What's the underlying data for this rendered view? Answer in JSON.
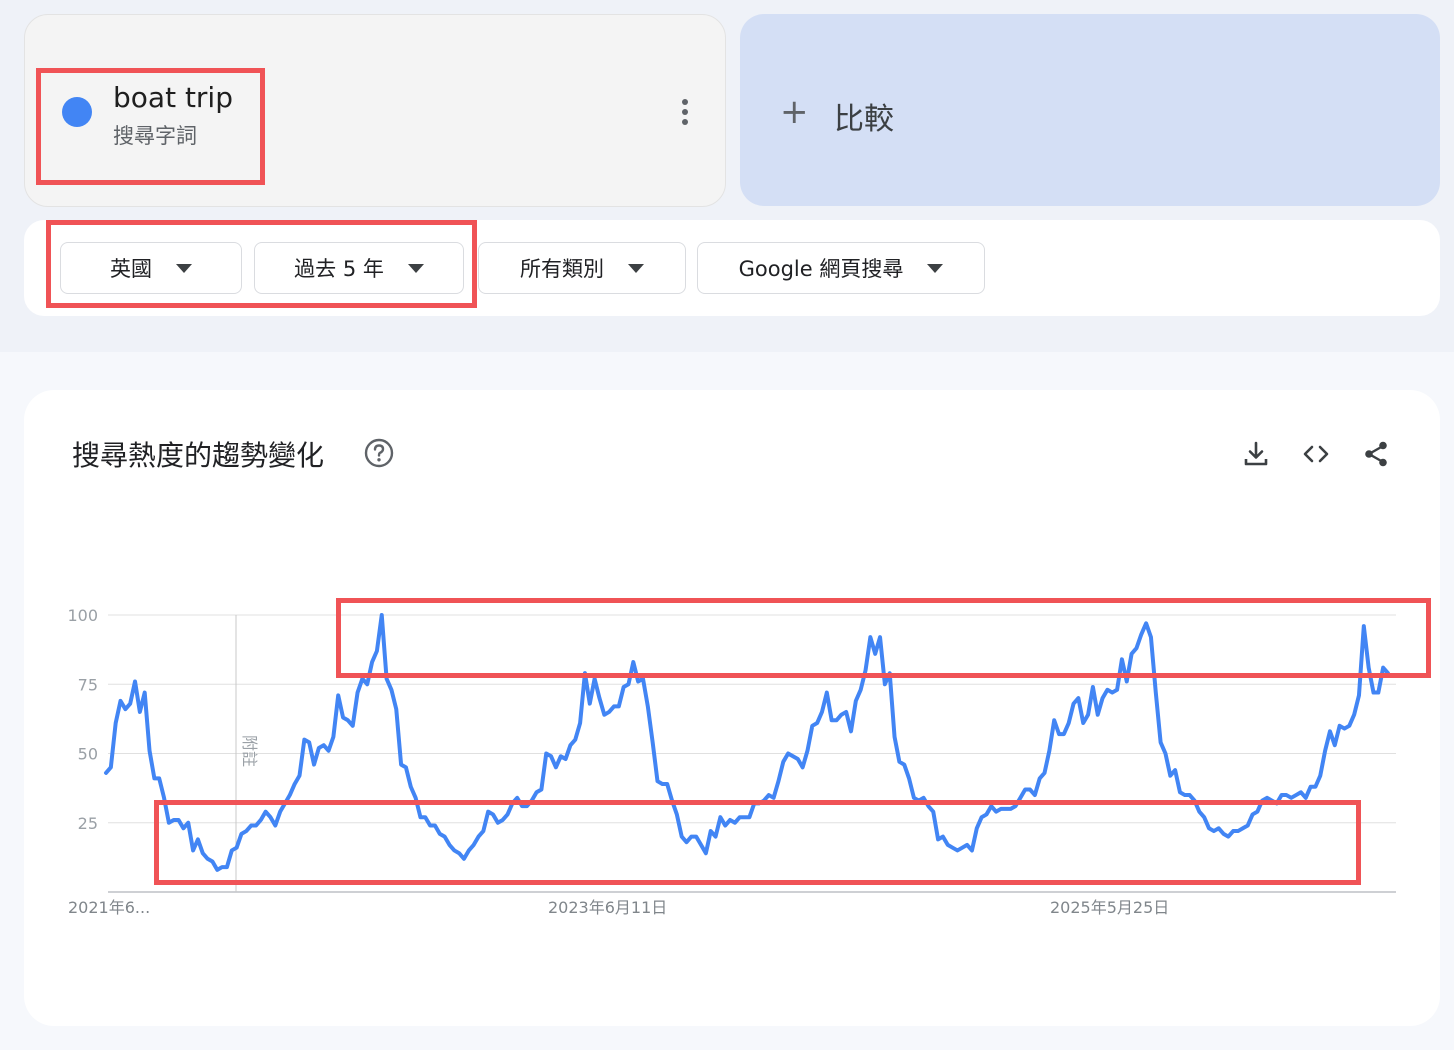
{
  "term": {
    "name": "boat trip",
    "type_label": "搜尋字詞",
    "color": "#4285f4"
  },
  "compare": {
    "plus": "+",
    "label": "比較"
  },
  "filters": [
    {
      "label": "英國"
    },
    {
      "label": "過去 5 年"
    },
    {
      "label": "所有類別"
    },
    {
      "label": "Google 網頁搜尋"
    }
  ],
  "chart_section": {
    "title": "搜尋熱度的趨勢變化",
    "help_icon": "help-circle-icon",
    "actions": [
      "download-icon",
      "embed-code-icon",
      "share-icon"
    ]
  },
  "colors": {
    "accent": "#4285f4",
    "highlight": "#f05356"
  },
  "chart_data": {
    "type": "line",
    "title": "",
    "xlabel": "",
    "ylabel": "",
    "ylim": [
      0,
      100
    ],
    "yticks": [
      25,
      50,
      75,
      100
    ],
    "xtick_labels": [
      "2021年6...",
      "2023年6月11日",
      "2025年5月25日"
    ],
    "annotation_label": "附註",
    "grid": true,
    "series": [
      {
        "name": "boat trip",
        "color": "#4285f4",
        "values": [
          43,
          45,
          61,
          69,
          66,
          68,
          76,
          65,
          72,
          51,
          41,
          41,
          34,
          25,
          26,
          26,
          23,
          25,
          15,
          19,
          14,
          12,
          11,
          8,
          9,
          9,
          15,
          16,
          21,
          22,
          24,
          24,
          26,
          29,
          27,
          24,
          29,
          32,
          35,
          39,
          42,
          55,
          54,
          46,
          52,
          53,
          51,
          56,
          71,
          63,
          62,
          60,
          72,
          77,
          75,
          83,
          87,
          100,
          77,
          73,
          66,
          46,
          45,
          38,
          34,
          27,
          27,
          24,
          24,
          21,
          20,
          17,
          15,
          14,
          12,
          15,
          17,
          20,
          22,
          29,
          28,
          25,
          26,
          28,
          32,
          34,
          31,
          31,
          33,
          36,
          37,
          50,
          49,
          45,
          49,
          48,
          53,
          55,
          61,
          79,
          68,
          77,
          70,
          64,
          65,
          67,
          67,
          74,
          75,
          83,
          76,
          77,
          67,
          54,
          40,
          39,
          39,
          33,
          28,
          20,
          18,
          20,
          20,
          17,
          14,
          22,
          20,
          27,
          24,
          26,
          25,
          27,
          27,
          27,
          32,
          32,
          33,
          35,
          34,
          40,
          47,
          50,
          49,
          48,
          45,
          51,
          60,
          61,
          65,
          72,
          62,
          62,
          64,
          65,
          58,
          69,
          73,
          80,
          92,
          86,
          92,
          75,
          79,
          56,
          47,
          46,
          41,
          34,
          33,
          34,
          31,
          29,
          19,
          20,
          17,
          16,
          15,
          16,
          17,
          15,
          23,
          27,
          28,
          31,
          29,
          30,
          30,
          30,
          31,
          34,
          37,
          37,
          35,
          41,
          43,
          51,
          62,
          57,
          57,
          61,
          68,
          70,
          61,
          64,
          74,
          64,
          70,
          73,
          72,
          73,
          84,
          76,
          86,
          88,
          93,
          97,
          92,
          72,
          54,
          50,
          42,
          44,
          36,
          35,
          35,
          33,
          29,
          27,
          23,
          22,
          23,
          21,
          20,
          22,
          22,
          23,
          24,
          28,
          29,
          33,
          34,
          33,
          32,
          35,
          35,
          34,
          35,
          36,
          34,
          38,
          38,
          42,
          51,
          58,
          53,
          60,
          59,
          60,
          64,
          71,
          96,
          81,
          72,
          72,
          81,
          79
        ]
      }
    ]
  }
}
